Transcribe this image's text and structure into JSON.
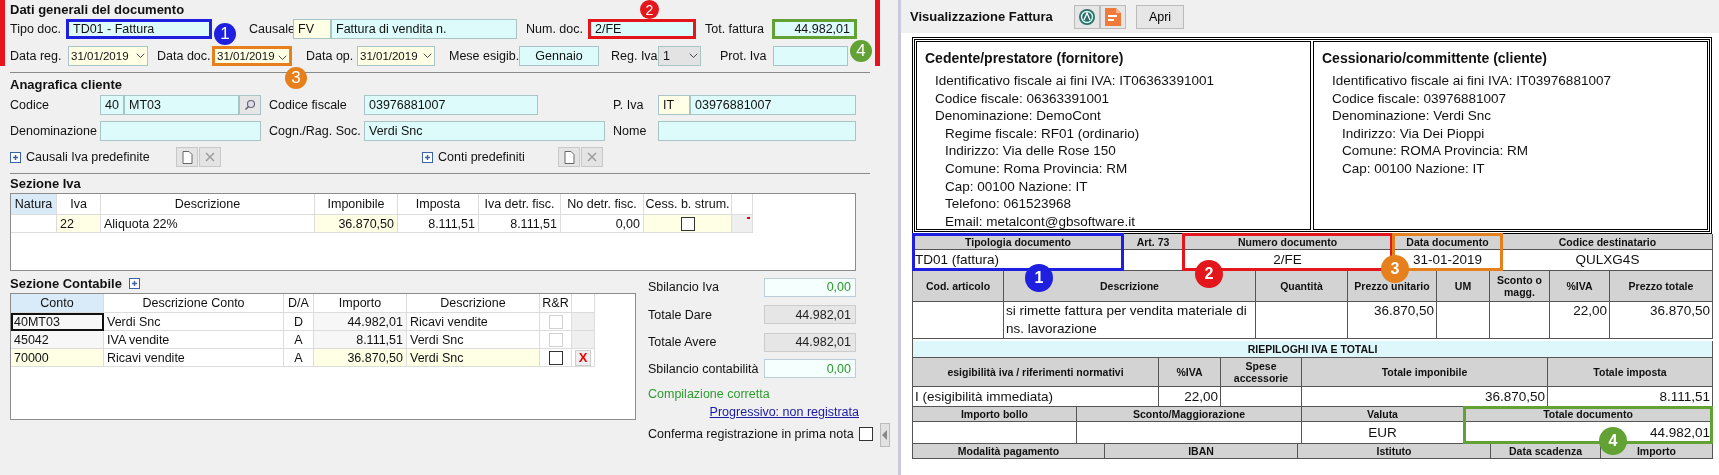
{
  "document_form": {
    "title": "Dati generali del documento",
    "row_1": [
      {
        "kind": "text",
        "label": "Tipo doc.",
        "value": "TD01 - Fattura",
        "annotation": {
          "number": "1",
          "color": "#1f1fe0"
        }
      },
      {
        "kind": "code_text",
        "label": "Causale",
        "code": "FV",
        "value": "Fattura di vendita n."
      },
      {
        "kind": "text",
        "label": "Num. doc.",
        "value": "2/FE",
        "annotation": {
          "number": "2",
          "color": "#e3161b"
        }
      },
      {
        "kind": "amount",
        "label": "Tot. fattura",
        "value": "44.982,01",
        "annotation": {
          "number": "4",
          "color": "#62a134"
        }
      }
    ],
    "row_2": [
      {
        "kind": "date",
        "label": "Data reg.",
        "value": "31/01/2019"
      },
      {
        "kind": "date",
        "label": "Data doc.",
        "value": "31/01/2019",
        "annotation": {
          "number": "3",
          "color": "#e5801c"
        }
      },
      {
        "kind": "date",
        "label": "Data op.",
        "value": "31/01/2019"
      },
      {
        "kind": "center",
        "label": "Mese esigib.",
        "value": "Gennaio"
      },
      {
        "kind": "combo",
        "label": "Reg. Iva",
        "value": "1"
      },
      {
        "kind": "text",
        "label": "Prot. Iva"
      }
    ]
  },
  "customer": {
    "title": "Anagrafica cliente",
    "row_1": [
      {
        "kind": "lookup",
        "label": "Codice",
        "code": "40",
        "value": "MT03"
      },
      {
        "kind": "text",
        "label": "Codice fiscale",
        "value": "03976881007"
      },
      {
        "kind": "code_text",
        "label": "P. Iva",
        "code": "IT",
        "value": "03976881007"
      }
    ],
    "row_2": [
      {
        "kind": "text",
        "label": "Denominazione"
      },
      {
        "kind": "text",
        "label": "Cogn./Rag. Soc.",
        "value": "Verdi Snc"
      },
      {
        "kind": "text",
        "label": "Nome"
      }
    ],
    "expanders": [
      {
        "label": "Causali Iva predefinite",
        "expanded": false
      },
      {
        "label": "Conti predefiniti",
        "expanded": false
      }
    ]
  },
  "vat_section": {
    "title": "Sezione Iva",
    "columns": [
      {
        "label": "Natura",
        "selected": true
      },
      {
        "label": "Iva",
        "selected": false
      },
      {
        "label": "Descrizione",
        "selected": false
      },
      {
        "label": "Imponibile",
        "selected": false
      },
      {
        "label": "Imposta",
        "selected": false
      },
      {
        "label": "Iva detr. fisc.",
        "selected": false
      },
      {
        "label": "No detr. fisc.",
        "selected": false
      },
      {
        "label": "Cess. b. strum.",
        "selected": false
      }
    ],
    "rows": [
      {
        "vat": "22",
        "description": "Aliquota 22%",
        "taxable": "36.870,50",
        "tax": "8.111,51",
        "deductible": "8.111,51",
        "non_deductible": "0,00",
        "capital_goods": false
      }
    ]
  },
  "accounting_section": {
    "title": "Sezione Contabile",
    "columns": [
      {
        "label": "Conto",
        "selected": true
      },
      {
        "label": "Descrizione Conto",
        "selected": false
      },
      {
        "label": "D/A",
        "selected": false
      },
      {
        "label": "Importo",
        "selected": false
      },
      {
        "label": "Descrizione",
        "selected": false
      },
      {
        "label": "R&R",
        "selected": false
      }
    ],
    "rows": [
      {
        "kind": "locked",
        "focused": true,
        "account": "40MT03",
        "account_description": "Verdi Snc",
        "side": "D",
        "amount": "44.982,01",
        "description": "Ricavi vendite",
        "reconciled": false
      },
      {
        "kind": "locked",
        "focused": false,
        "account": "45042",
        "account_description": "IVA vendite",
        "side": "A",
        "amount": "8.111,51",
        "description": "Verdi Snc",
        "reconciled": false
      },
      {
        "kind": "editable",
        "focused": false,
        "account": "70000",
        "account_description": "Ricavi vendite",
        "side": "A",
        "amount": "36.870,50",
        "description": "Verdi Snc",
        "reconciled": false,
        "delete_label": "X"
      }
    ]
  },
  "balance": {
    "fields": [
      {
        "kind": "ok",
        "label": "Sbilancio Iva",
        "value": "0,00"
      },
      {
        "kind": "total",
        "label": "Totale Dare",
        "value": "44.982,01"
      },
      {
        "kind": "total",
        "label": "Totale Avere",
        "value": "44.982,01"
      },
      {
        "kind": "ok",
        "label": "Sbilancio contabilità",
        "value": "0,00"
      }
    ],
    "status": "Compilazione corretta",
    "link": "Progressivo: non registrata",
    "confirm": {
      "label": "Conferma registrazione in prima nota",
      "checked": false
    }
  },
  "invoice_view": {
    "title": "Visualizzazione Fattura",
    "open_button": "Apri",
    "parties": [
      {
        "title": "Cedente/prestatore (fornitore)",
        "lines": [
          {
            "text": "Identificativo fiscale ai fini IVA: IT06363391001"
          },
          {
            "text": "Codice fiscale: 06363391001"
          },
          {
            "text": "Denominazione: DemoCont",
            "children": [
              {
                "text": "Regime fiscale: RF01 (ordinario)"
              },
              {
                "text": "Indirizzo: Via delle Rose 150"
              },
              {
                "text": "Comune: Roma Provincia: RM"
              },
              {
                "text": "Cap: 00100 Nazione: IT"
              },
              {
                "text": "Telefono: 061523968"
              },
              {
                "text": "Email: metalcont@gbsoftware.it"
              }
            ]
          }
        ]
      },
      {
        "title": "Cessionario/committente (cliente)",
        "lines": [
          {
            "text": "Identificativo fiscale ai fini IVA: IT03976881007"
          },
          {
            "text": "Codice fiscale: 03976881007"
          },
          {
            "text": "Denominazione: Verdi Snc",
            "children": [
              {
                "text": "Indirizzo: Via Dei Pioppi"
              },
              {
                "text": "Comune: ROMA Provincia: RM"
              },
              {
                "text": "Cap: 00100 Nazione: IT"
              }
            ]
          }
        ]
      }
    ],
    "document_header": [
      {
        "label": "Tipologia documento",
        "value": "TD01 (fattura)",
        "annotation": {
          "number": "1",
          "color": "#1f1fe0"
        }
      },
      {
        "label": "Art. 73"
      },
      {
        "label": "Numero documento",
        "value": "2/FE",
        "annotation": {
          "number": "2",
          "color": "#e3161b"
        }
      },
      {
        "label": "Data documento",
        "value": "31-01-2019",
        "annotation": {
          "number": "3",
          "color": "#e5801c"
        }
      },
      {
        "label": "Codice destinatario",
        "value": "QULXG4S"
      }
    ],
    "lines_columns": [
      "Cod. articolo",
      "Descrizione",
      "Quantità",
      "Prezzo unitario",
      "UM",
      "Sconto o magg.",
      "%IVA",
      "Prezzo totale"
    ],
    "lines": [
      {
        "description": "si rimette fattura per vendita materiale di ns. lavorazione",
        "unit_price": "36.870,50",
        "vat_rate": "22,00",
        "total_price": "36.870,50"
      }
    ],
    "summary_title": "RIEPILOGHI IVA E TOTALI",
    "vat_summary_columns": [
      "esigibilità iva / riferimenti normativi",
      "%IVA",
      "Spese accessorie",
      "Totale imponibile",
      "Totale imposta"
    ],
    "vat_summary": [
      {
        "eligibility": "I (esigibilità immediata)",
        "vat_rate": "22,00",
        "taxable": "36.870,50",
        "tax": "8.111,51"
      }
    ],
    "totals": [
      {
        "label": "Importo bollo"
      },
      {
        "label": "Sconto/Maggiorazione"
      },
      {
        "label": "Valuta",
        "value": "EUR"
      },
      {
        "label": "Totale documento",
        "value": "44.982,01",
        "annotation": {
          "number": "4",
          "color": "#62a134"
        }
      }
    ],
    "payment_columns": [
      "Modalità pagamento",
      "IBAN",
      "Istituto",
      "Data scadenza",
      "Importo"
    ]
  }
}
